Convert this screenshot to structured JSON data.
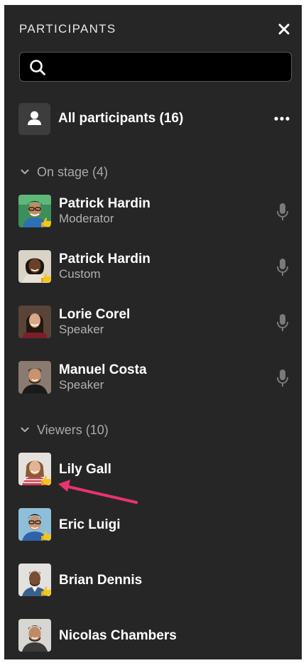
{
  "header": {
    "title": "PARTICIPANTS",
    "close_icon": "close-icon"
  },
  "search": {
    "placeholder": "",
    "value": "",
    "icon": "search-icon"
  },
  "all_participants": {
    "label": "All participants (16)",
    "icon": "person-icon",
    "more_icon": "more-horizontal-icon"
  },
  "on_stage": {
    "label": "On stage (4)",
    "people": [
      {
        "name": "Patrick Hardin",
        "role": "Moderator",
        "hand_raised": true,
        "mic": true
      },
      {
        "name": "Patrick Hardin",
        "role": "Custom",
        "hand_raised": true,
        "mic": true
      },
      {
        "name": "Lorie Corel",
        "role": "Speaker",
        "hand_raised": false,
        "mic": true
      },
      {
        "name": "Manuel Costa",
        "role": "Speaker",
        "hand_raised": false,
        "mic": true
      }
    ]
  },
  "viewers": {
    "label": "Viewers (10)",
    "people": [
      {
        "name": "Lily Gall",
        "hand_raised": true
      },
      {
        "name": "Eric Luigi",
        "hand_raised": true
      },
      {
        "name": "Brian Dennis",
        "hand_raised": true
      },
      {
        "name": "Nicolas Chambers",
        "hand_raised": false
      }
    ]
  },
  "colors": {
    "panel_bg": "#262626",
    "text_primary": "#ffffff",
    "text_secondary": "#b0b0b0",
    "mic_icon": "#7a7a7a",
    "hand_emoji": "#f5c518",
    "annotation_arrow": "#e8336d"
  }
}
